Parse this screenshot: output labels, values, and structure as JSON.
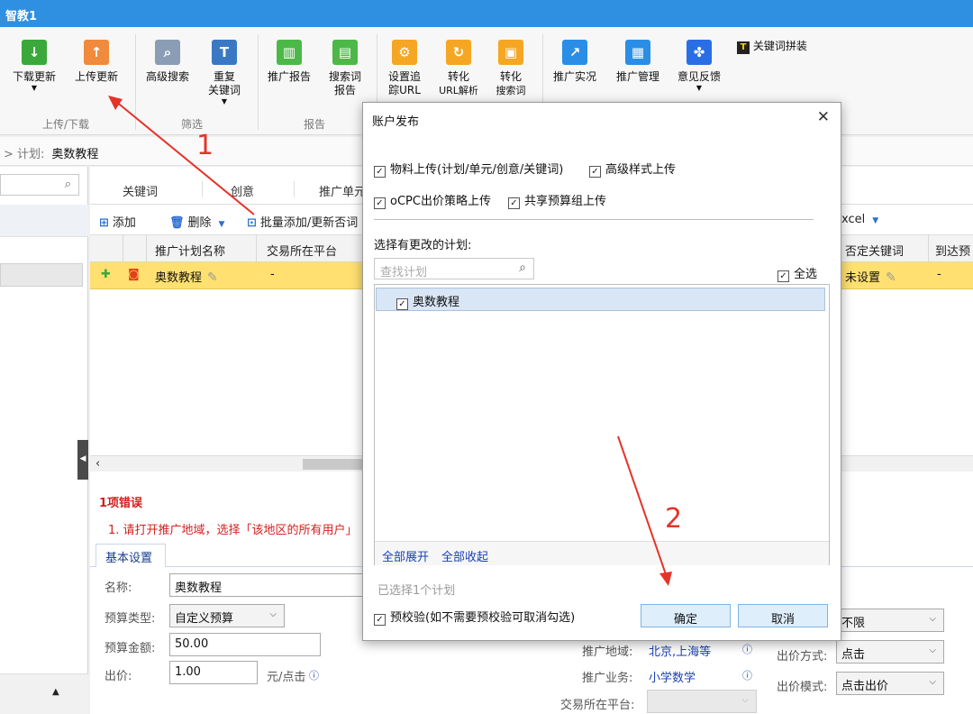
{
  "window": {
    "title": "智教1"
  },
  "ribbon": {
    "buttons": [
      {
        "label": "下载更新",
        "icon": "download-arrow-icon",
        "color": "#3aa83a"
      },
      {
        "label": "上传更新",
        "icon": "upload-arrow-icon",
        "color": "#f08a3c"
      },
      {
        "label": "高级搜索",
        "icon": "magnifier-doc-icon",
        "color": "#8a9db5"
      },
      {
        "label": "重复",
        "label2": "关键词",
        "icon": "duplicate-keyword-icon",
        "color": "#3b78c4"
      },
      {
        "label": "推广报告",
        "icon": "bar-report-icon",
        "color": "#4cb848"
      },
      {
        "label": "搜索词",
        "label2": "报告",
        "icon": "search-report-icon",
        "color": "#4cb848"
      },
      {
        "label": "设置追",
        "label2": "踪URL",
        "icon": "gear-icon",
        "color": "#f5a623"
      },
      {
        "label": "转化",
        "label2": "URL解析",
        "icon": "refresh-icon",
        "color": "#f5a623"
      },
      {
        "label": "转化",
        "label2": "搜索词",
        "icon": "doc-search-icon",
        "color": "#f5a623"
      },
      {
        "label": "推广实况",
        "icon": "share-live-icon",
        "color": "#2a8ee6"
      },
      {
        "label": "推广管理",
        "icon": "manage-icon",
        "color": "#2a8ee6"
      },
      {
        "label": "意见反馈",
        "icon": "baidu-paw-icon",
        "color": "#2a6ee6"
      },
      {
        "label": "关键词拼装",
        "icon": "keyword-combine-icon",
        "color": "#222222"
      }
    ],
    "groups": [
      "上传/下载",
      "筛选",
      "报告"
    ]
  },
  "breadcrumb": {
    "prefix": "> 计划:",
    "current": "奥数教程"
  },
  "tabs": [
    "关键词",
    "创意",
    "推广单元"
  ],
  "toolbar": {
    "add": "添加",
    "delete": "删除",
    "batch": "批量添加/更新否词",
    "excel": "xcel"
  },
  "grid": {
    "headers": [
      "推广计划名称",
      "交易所在平台",
      "否定关键词",
      "到达预"
    ],
    "row": {
      "name": "奥数教程",
      "platform": "-",
      "negative": "未设置",
      "reach": "-"
    }
  },
  "errors": {
    "title": "1项错误",
    "message": "1. 请打开推广地域，选择「该地区的所有用户」"
  },
  "settings": {
    "tab": "基本设置",
    "name_label": "名称:",
    "name_value": "奥数教程",
    "budget_type_label": "预算类型:",
    "budget_type_value": "自定义预算",
    "budget_amount_label": "预算金额:",
    "budget_amount_value": "50.00",
    "bid_label": "出价:",
    "bid_value": "1.00",
    "bid_unit": "元/点击",
    "region_label": "推广地域:",
    "region_value": "北京,上海等",
    "business_label": "推广业务:",
    "business_value": "小学数学",
    "platform_label": "交易所在平台:",
    "right_select1": "不限",
    "bid_method_label": "出价方式:",
    "bid_method_value": "点击",
    "bid_mode_label": "出价模式:",
    "bid_mode_value": "点击出价"
  },
  "dialog": {
    "title": "账户发布",
    "opt_material": "物料上传(计划/单元/创意/关键词)",
    "opt_style": "高级样式上传",
    "opt_ocpc": "oCPC出价策略上传",
    "opt_budget": "共享预算组上传",
    "plans_label": "选择有更改的计划:",
    "search_placeholder": "查找计划",
    "select_all": "全选",
    "plan_item": "奥数教程",
    "expand_all": "全部展开",
    "collapse_all": "全部收起",
    "selected_count": "已选择1个计划",
    "precheck": "预校验(如不需要预校验可取消勾选)",
    "ok": "确定",
    "cancel": "取消"
  },
  "annotations": {
    "step1": "1",
    "step2": "2",
    "color": "#e53329"
  }
}
